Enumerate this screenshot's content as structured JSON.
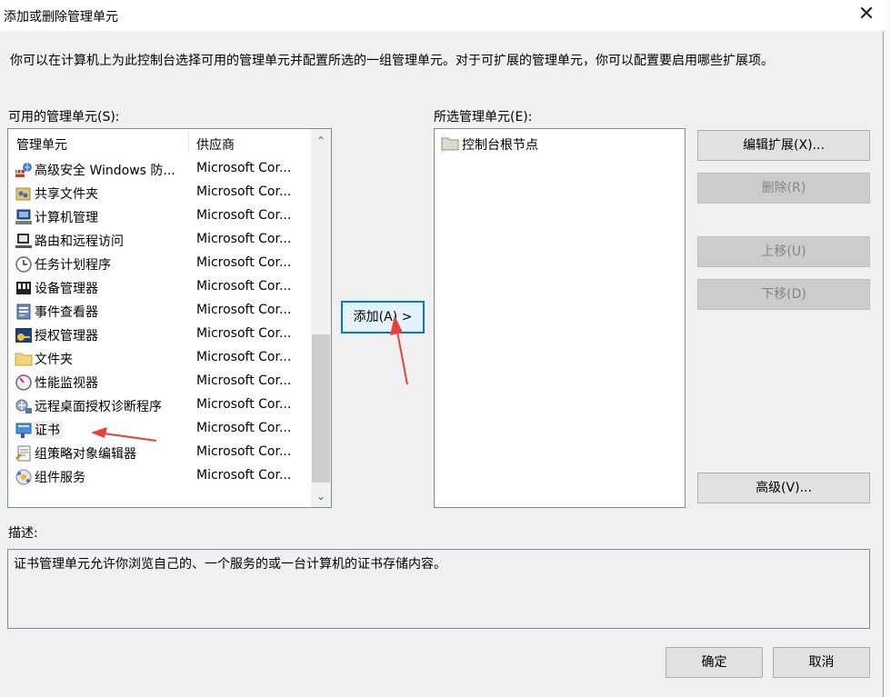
{
  "window": {
    "title": "添加或删除管理单元",
    "close_glyph": "✕"
  },
  "intro_text": "你可以在计算机上为此控制台选择可用的管理单元并配置所选的一组管理单元。对于可扩展的管理单元，你可以配置要启用哪些扩展项。",
  "available": {
    "label": "可用的管理单元(S):",
    "columns": {
      "name": "管理单元",
      "vendor": "供应商"
    },
    "items": [
      {
        "name": "高级安全 Windows 防...",
        "vendor": "Microsoft Cor...",
        "icon": "firewall-icon"
      },
      {
        "name": "共享文件夹",
        "vendor": "Microsoft Cor...",
        "icon": "shared-folder-icon"
      },
      {
        "name": "计算机管理",
        "vendor": "Microsoft Cor...",
        "icon": "computer-management-icon"
      },
      {
        "name": "路由和远程访问",
        "vendor": "Microsoft Cor...",
        "icon": "routing-icon"
      },
      {
        "name": "任务计划程序",
        "vendor": "Microsoft Cor...",
        "icon": "clock-icon"
      },
      {
        "name": "设备管理器",
        "vendor": "Microsoft Cor...",
        "icon": "device-manager-icon"
      },
      {
        "name": "事件查看器",
        "vendor": "Microsoft Cor...",
        "icon": "event-viewer-icon"
      },
      {
        "name": "授权管理器",
        "vendor": "Microsoft Cor...",
        "icon": "authorization-icon"
      },
      {
        "name": "文件夹",
        "vendor": "Microsoft Cor...",
        "icon": "folder-icon"
      },
      {
        "name": "性能监视器",
        "vendor": "Microsoft Cor...",
        "icon": "performance-icon"
      },
      {
        "name": "远程桌面授权诊断程序",
        "vendor": "Microsoft Cor...",
        "icon": "remote-desktop-icon"
      },
      {
        "name": "证书",
        "vendor": "Microsoft Cor...",
        "icon": "certificate-icon"
      },
      {
        "name": "组策略对象编辑器",
        "vendor": "Microsoft Cor...",
        "icon": "group-policy-icon"
      },
      {
        "name": "组件服务",
        "vendor": "Microsoft Cor...",
        "icon": "component-services-icon"
      }
    ]
  },
  "add_button": "添加(A) >",
  "selected": {
    "label": "所选管理单元(E):",
    "items": [
      {
        "name": "控制台根节点",
        "icon": "folder-icon"
      }
    ]
  },
  "side_buttons": {
    "edit_extensions": "编辑扩展(X)...",
    "remove": "删除(R)",
    "move_up": "上移(U)",
    "move_down": "下移(D)",
    "advanced": "高级(V)..."
  },
  "description": {
    "label": "描述:",
    "text": "证书管理单元允许你浏览自己的、一个服务的或一台计算机的证书存储内容。"
  },
  "footer": {
    "ok": "确定",
    "cancel": "取消"
  },
  "colors": {
    "accent": "#0078d7",
    "annotation_arrow": "#e8413a"
  }
}
